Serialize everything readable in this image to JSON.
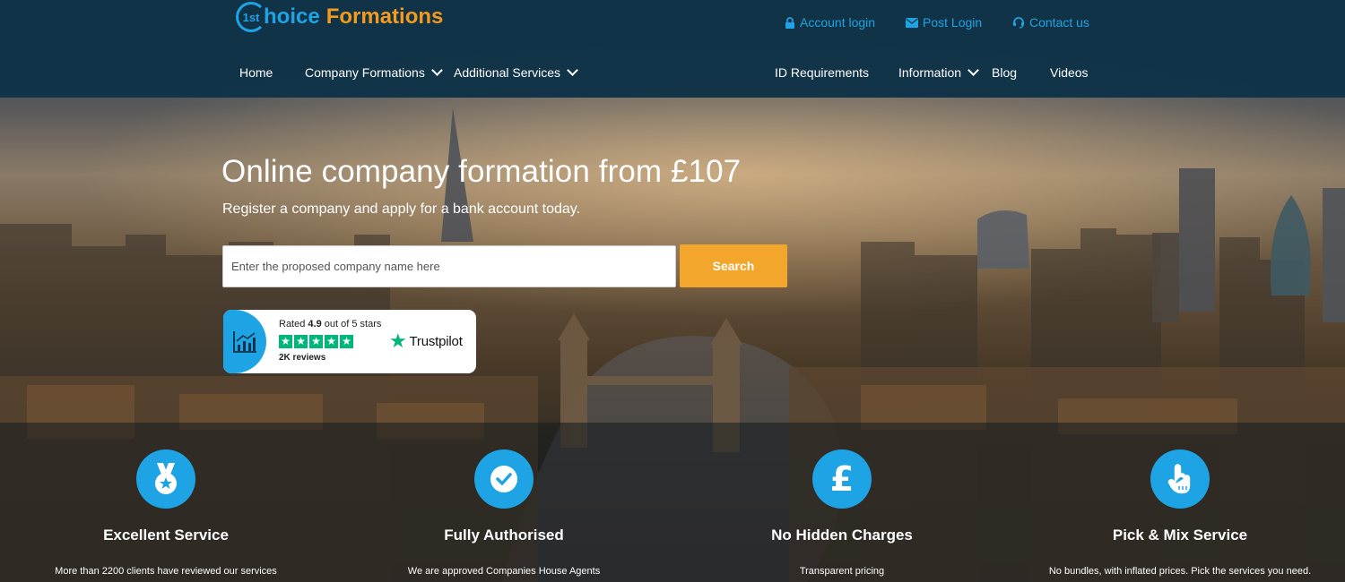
{
  "brand": {
    "logo_mark": "1st",
    "logo_word_a": "hoice",
    "logo_word_b": "Formations",
    "primary_color": "#1ea4e4",
    "accent_color": "#f39a1f"
  },
  "top_links": [
    {
      "label": "Account login",
      "icon": "lock-icon"
    },
    {
      "label": "Post Login",
      "icon": "envelope-icon"
    },
    {
      "label": "Contact us",
      "icon": "headset-icon"
    }
  ],
  "nav": {
    "left": [
      {
        "label": "Home",
        "has_dropdown": false
      },
      {
        "label": "Company Formations",
        "has_dropdown": true
      },
      {
        "label": "Additional Services",
        "has_dropdown": true
      }
    ],
    "right": [
      {
        "label": "ID Requirements",
        "has_dropdown": false
      },
      {
        "label": "Information",
        "has_dropdown": true
      },
      {
        "label": "Blog",
        "has_dropdown": false
      },
      {
        "label": "Videos",
        "has_dropdown": false
      }
    ]
  },
  "hero": {
    "title": "Online company formation from £107",
    "subtitle": "Register a company and apply for a bank account today.",
    "search_placeholder": "Enter the proposed company name here",
    "search_value": "",
    "search_button": "Search",
    "search_button_color": "#f2a72c"
  },
  "trustpilot": {
    "rated_prefix": "Rated ",
    "rating": "4.9",
    "rated_suffix": " out of 5 stars",
    "stars": 5,
    "reviews": "2K reviews",
    "brand": "Trustpilot",
    "star_color": "#00b67a"
  },
  "features": [
    {
      "icon": "medal-icon",
      "title": "Excellent Service",
      "desc": "More than 2200 clients have reviewed our services"
    },
    {
      "icon": "check-circle-icon",
      "title": "Fully Authorised",
      "desc": "We are approved Companies House Agents"
    },
    {
      "icon": "pound-icon",
      "title": "No Hidden Charges",
      "desc": "Transparent pricing"
    },
    {
      "icon": "hand-pointer-icon",
      "title": "Pick & Mix Service",
      "desc": "No bundles, with inflated prices. Pick the services you need."
    }
  ]
}
